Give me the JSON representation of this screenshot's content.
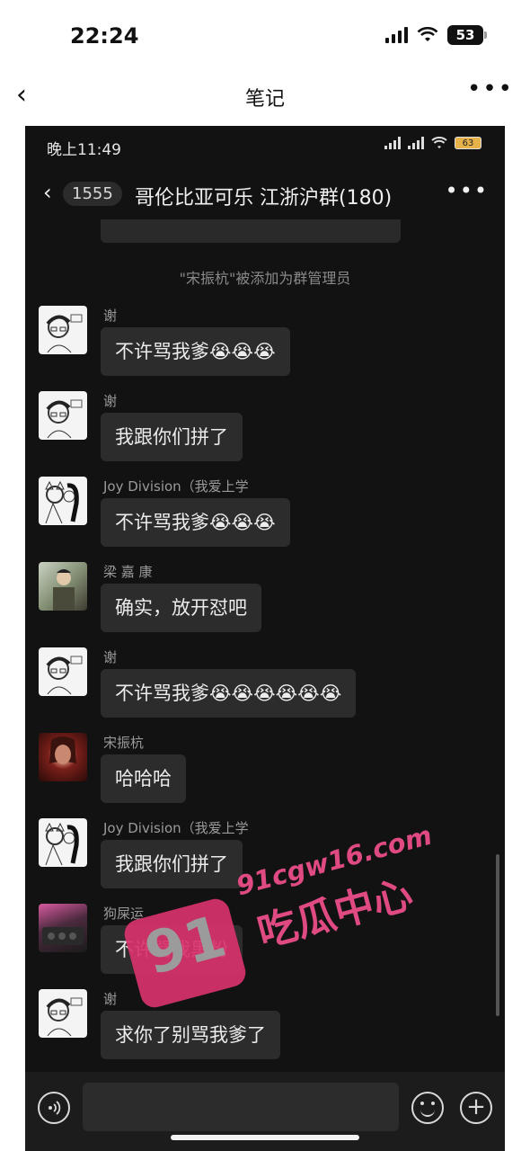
{
  "outer_status": {
    "time": "22:24",
    "battery": "53"
  },
  "outer_nav": {
    "back_glyph": "‹",
    "title": "笔记",
    "more_glyph": "•••"
  },
  "inner_status": {
    "time": "晚上11:49",
    "battery": "63"
  },
  "chat_header": {
    "back_glyph": "‹",
    "unread_count": "1555",
    "title": "哥伦比亚可乐 江浙沪群(180)",
    "more_glyph": "•••"
  },
  "system_message": "\"宋振杭\"被添加为群管理员",
  "messages": [
    {
      "sender": "谢",
      "text": "不许骂我爹😭😭😭",
      "avatar": "sketch-avatar"
    },
    {
      "sender": "谢",
      "text": "我跟你们拼了",
      "avatar": "sketch-avatar"
    },
    {
      "sender": "Joy Division（我爱上学",
      "text": "不许骂我爹😭😭😭",
      "avatar": "sketch-cat-avatar"
    },
    {
      "sender": "梁 嘉 康",
      "text": "确实，放开怼吧",
      "avatar": "photo-avatar"
    },
    {
      "sender": "谢",
      "text": "不许骂我爹😭😭😭😭😭😭",
      "avatar": "sketch-avatar"
    },
    {
      "sender": "宋振杭",
      "text": "哈哈哈",
      "avatar": "photo-avatar"
    },
    {
      "sender": "Joy Division（我爱上学",
      "text": "我跟你们拼了",
      "avatar": "sketch-cat-avatar"
    },
    {
      "sender": "狗屎运",
      "text": "不许骂我黑粉",
      "avatar": "photo-avatar"
    },
    {
      "sender": "谢",
      "text": "求你了别骂我爹了",
      "avatar": "sketch-avatar"
    }
  ],
  "input": {
    "placeholder": ""
  },
  "watermark": {
    "url": "91cgw16.com",
    "name": "吃瓜中心",
    "logo": "91"
  },
  "colors": {
    "background": "#121212",
    "bubble": "#2c2c2c",
    "watermark": "#e04a82"
  }
}
